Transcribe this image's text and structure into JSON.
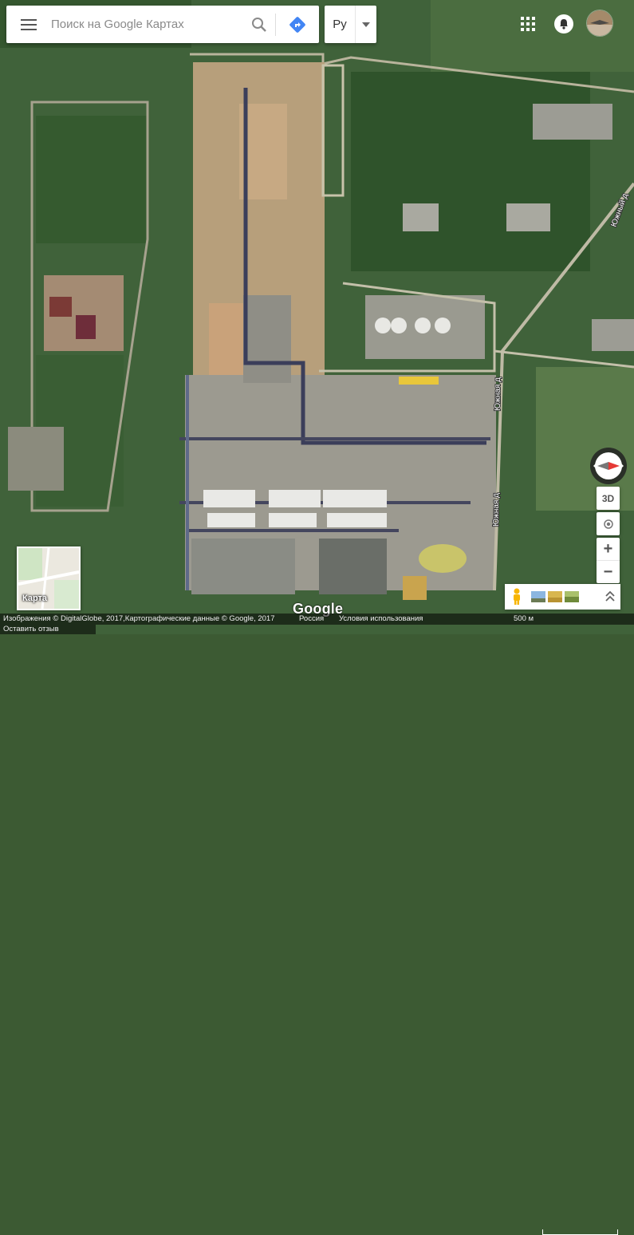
{
  "search": {
    "placeholder": "Поиск на Google Картах"
  },
  "language": {
    "label": "Ру"
  },
  "map_type": {
    "label": "Карта"
  },
  "controls": {
    "three_d_label": "3D",
    "zoom_in_label": "+",
    "zoom_out_label": "−"
  },
  "map_labels": {
    "road1": "Южный д",
    "road2": "Южная д",
    "road3": "Южная д"
  },
  "brand": {
    "logo": "Google"
  },
  "footer": {
    "attribution": "Изображения © DigitalGlobe, 2017,Картографические данные © Google, 2017",
    "country": "Россия",
    "terms": "Условия использования",
    "scale": "500 м",
    "feedback": "Оставить отзыв"
  },
  "icons": {
    "menu": "hamburger-icon",
    "search": "search-icon",
    "directions": "directions-icon",
    "apps": "apps-grid-icon",
    "notifications": "notifications-icon",
    "compass": "compass-icon",
    "locate": "my-location-icon",
    "pegman": "pegman-icon",
    "expand": "expand-icon"
  },
  "colors": {
    "directions": "#4285f4",
    "compass_red": "#e53935",
    "imagery_green": "#3f6a35"
  }
}
